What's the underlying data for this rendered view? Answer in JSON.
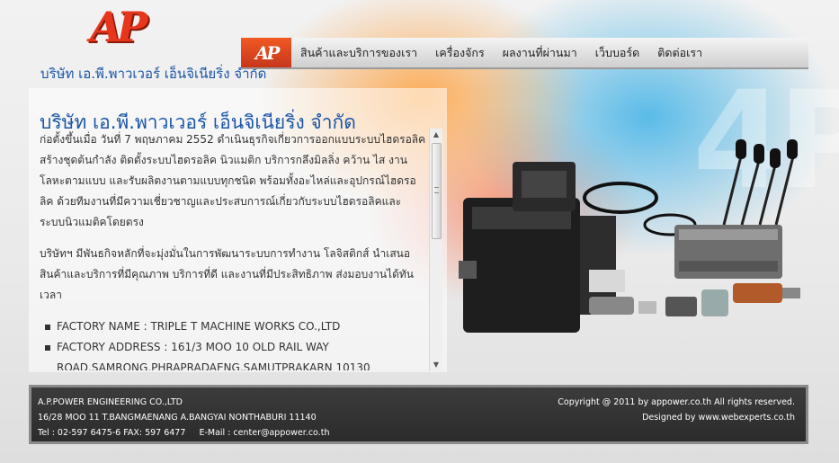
{
  "brand": {
    "logo_text": "AP",
    "company_name_top": "บริษัท เอ.พี.พาวเวอร์ เอ็นจิเนียริ่ง จำกัด"
  },
  "nav": {
    "logo_text": "AP",
    "items": [
      {
        "label": "สินค้าและบริการของเรา"
      },
      {
        "label": "เครื่องจักร"
      },
      {
        "label": "ผลงานที่ผ่านมา"
      },
      {
        "label": "เว็บบอร์ด"
      },
      {
        "label": "ติดต่อเรา"
      }
    ]
  },
  "content": {
    "title": "บริษัท เอ.พี.พาวเวอร์ เอ็นจิเนียริ่ง จำกัด",
    "paragraphs": [
      "ก่อตั้งขึ้นเมื่อ วันที่ 7 พฤษภาคม 2552 ดำเนินธุรกิจเกี่ยวการออกแบบระบบไฮดรอลิค สร้างชุดต้นกำลัง ติดตั้งระบบไฮดรอลิค นิวแมติก บริการกลึงมิลลิ่ง คว้าน ไส งาน โลหะตามแบบ และรับผลิตงานตามแบบทุกชนิด พร้อมทั้งอะไหล่และอุปกรณ์ไฮดรอลิค ด้วยทีมงานที่มีความเชี่ยวชาญและประสบการณ์เกี่ยวกับระบบไฮดรอลิคและระบบนิวแมติคโดยตรง",
      "บริษัทฯ มีพันธกิจหลักที่จะมุ่งมั่นในการพัฒนาระบบการทำงาน โลจิสติกส์ นำเสนอสินค้าและบริการที่มีคุณภาพ บริการที่ดี และงานที่มีประสิทธิภาพ ส่งมอบงานได้ทันเวลา"
    ],
    "list": [
      "FACTORY NAME : TRIPLE T MACHINE WORKS CO.,LTD",
      "FACTORY ADDRESS : 161/3 MOO 10 OLD RAIL WAY ROAD,SAMRONG,PHRAPRADAENG,SAMUTPRAKARN 10130"
    ]
  },
  "footer": {
    "company": "A.P.POWER ENGINEERING CO.,LTD",
    "address": "16/28 MOO 11 T.BANGMAENANG A.BANGYAI NONTHABURI 11140",
    "phone": "Tel : 02-597 6475-6 FAX: 597 6477",
    "email": "E-Mail : center@appower.co.th",
    "copyright": "Copyright @ 2011 by appower.co.th All rights reserved.",
    "designed_by": "Designed by www.webexperts.co.th"
  },
  "colors": {
    "accent": "#1a55a8",
    "brand_red": "#e8361c"
  }
}
